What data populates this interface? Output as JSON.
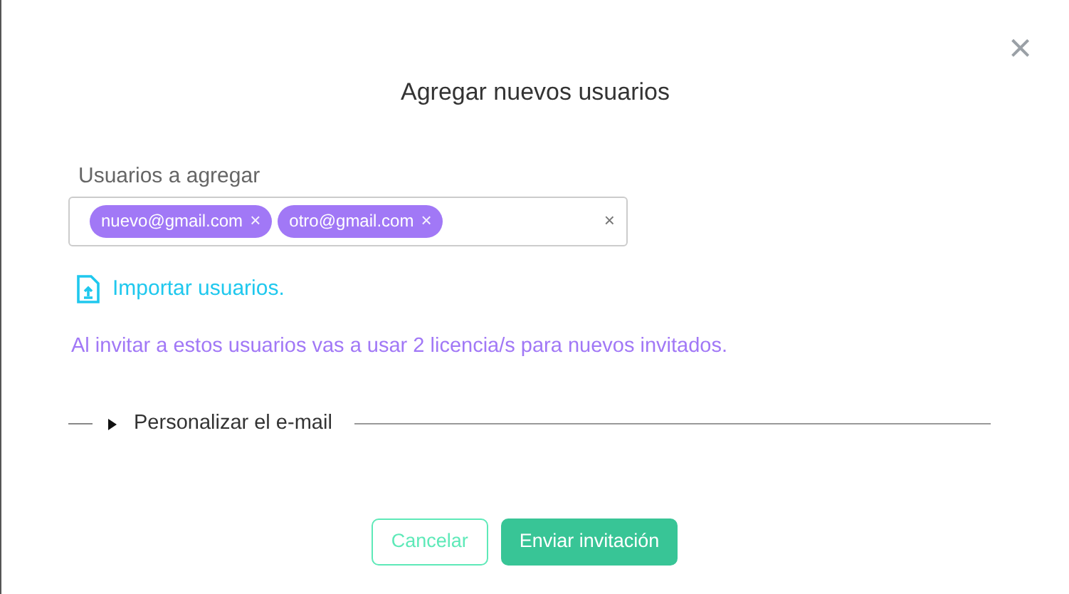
{
  "dialog": {
    "title": "Agregar nuevos usuarios",
    "close": "×"
  },
  "users_field": {
    "label": "Usuarios a agregar",
    "tags": [
      {
        "text": "nuevo@gmail.com",
        "remove": "×"
      },
      {
        "text": "otro@gmail.com",
        "remove": "×"
      }
    ],
    "clear": "×"
  },
  "import_link": "Importar usuarios.",
  "notice": "Al invitar a estos usuarios vas a usar 2 licencia/s para nuevos invitados.",
  "customize_email": {
    "label": "Personalizar el e-mail",
    "expanded": false
  },
  "buttons": [
    {
      "label": "Cancelar",
      "kind": "outline"
    },
    {
      "label": "Enviar invitación",
      "kind": "primary"
    }
  ]
}
